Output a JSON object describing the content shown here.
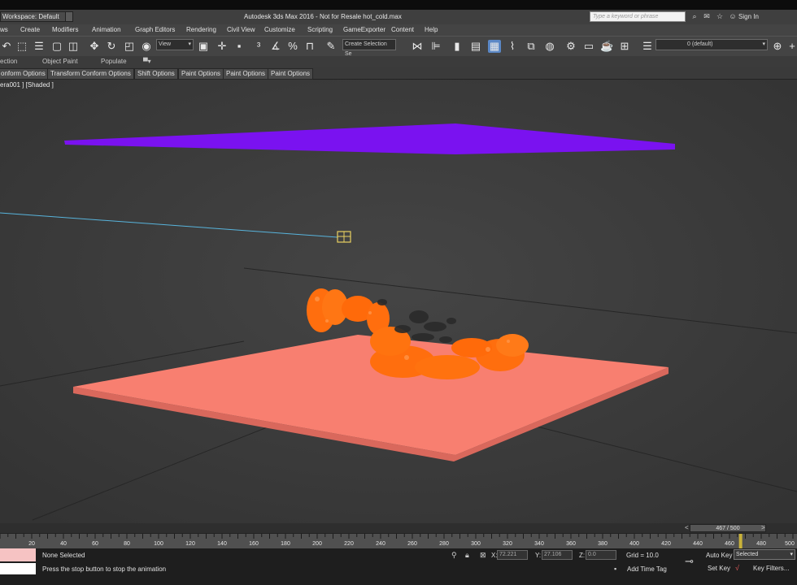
{
  "titlebar": {
    "workspace": "Workspace: Default",
    "title": "Autodesk 3ds Max 2016 - Not for Resale   hot_cold.max",
    "search_placeholder": "Type a keyword or phrase",
    "sign_in": "Sign In"
  },
  "menu": [
    "ws",
    "Create",
    "Modifiers",
    "Animation",
    "Graph Editors",
    "Rendering",
    "Civil View",
    "Customize",
    "Scripting",
    "GameExporter",
    "Content",
    "Help"
  ],
  "toolbar": {
    "view_combo": "View",
    "selection_set": "Create Selection Se",
    "layer": "0 (default)"
  },
  "ribbon": [
    "ection",
    "Object Paint",
    "Populate"
  ],
  "paint_tabs": [
    "onform Options",
    "Transform Conform Options",
    "Shift Options",
    "Paint Options",
    "Paint Options",
    "Paint Options"
  ],
  "viewport": {
    "label": "era001 ] [Shaded ]",
    "colors": {
      "top_plane": "#7a12f0",
      "bottom_plane": "#f87f70",
      "fluid": "#ff6e0e",
      "background": "#3e3e3e"
    }
  },
  "timeline": {
    "frame_counter": "467 / 500",
    "current_frame": 467,
    "total_frames": 500,
    "tick_labels": [
      "20",
      "40",
      "60",
      "80",
      "100",
      "120",
      "140",
      "160",
      "180",
      "200",
      "220",
      "240",
      "260",
      "280",
      "300",
      "320",
      "340",
      "360",
      "380",
      "400",
      "420",
      "440",
      "460",
      "480",
      "500"
    ]
  },
  "status": {
    "selection": "None Selected",
    "prompt": "Press the stop button to stop the animation",
    "x_label": "X:",
    "x_value": "72.221",
    "y_label": "Y:",
    "y_value": "27.106",
    "z_label": "Z:",
    "z_value": "0.0",
    "grid": "Grid = 10.0",
    "add_time_tag": "Add Time Tag",
    "auto_key": "Auto Key",
    "set_key": "Set Key",
    "key_mode": "Selected",
    "key_filters": "Key Filters..."
  }
}
